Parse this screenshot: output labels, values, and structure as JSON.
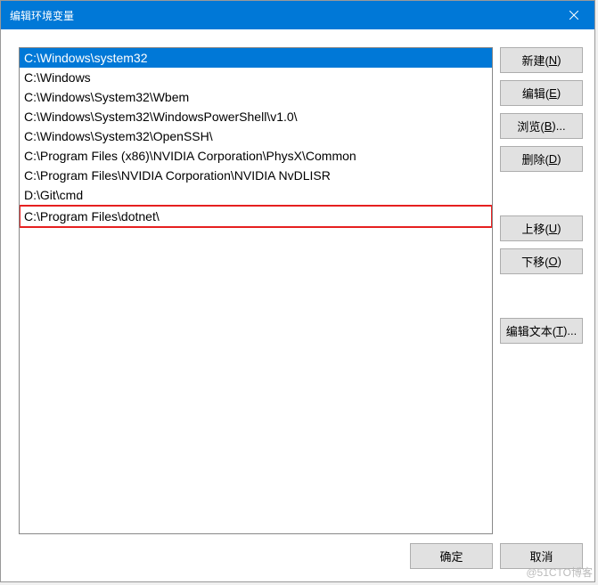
{
  "titlebar": {
    "title": "编辑环境变量"
  },
  "list": {
    "items": [
      {
        "path": "C:\\Windows\\system32",
        "selected": true
      },
      {
        "path": "C:\\Windows"
      },
      {
        "path": "C:\\Windows\\System32\\Wbem"
      },
      {
        "path": "C:\\Windows\\System32\\WindowsPowerShell\\v1.0\\"
      },
      {
        "path": "C:\\Windows\\System32\\OpenSSH\\"
      },
      {
        "path": "C:\\Program Files (x86)\\NVIDIA Corporation\\PhysX\\Common"
      },
      {
        "path": "C:\\Program Files\\NVIDIA Corporation\\NVIDIA NvDLISR"
      },
      {
        "path": "D:\\Git\\cmd"
      },
      {
        "path": "C:\\Program Files\\dotnet\\",
        "highlighted": true
      }
    ]
  },
  "buttons": {
    "new_prefix": "新建(",
    "new_mn": "N",
    "new_suffix": ")",
    "edit_prefix": "编辑(",
    "edit_mn": "E",
    "edit_suffix": ")",
    "browse_prefix": "浏览(",
    "browse_mn": "B",
    "browse_suffix": ")...",
    "delete_prefix": "删除(",
    "delete_mn": "D",
    "delete_suffix": ")",
    "moveup_prefix": "上移(",
    "moveup_mn": "U",
    "moveup_suffix": ")",
    "movedown_prefix": "下移(",
    "movedown_mn": "O",
    "movedown_suffix": ")",
    "edittext_prefix": "编辑文本(",
    "edittext_mn": "T",
    "edittext_suffix": ")...",
    "ok": "确定",
    "cancel": "取消"
  },
  "watermark": "@51CTO博客"
}
